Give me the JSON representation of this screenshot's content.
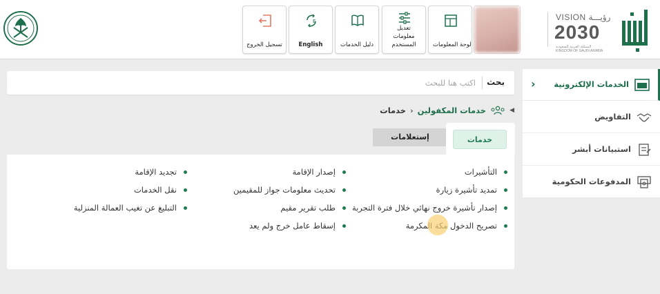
{
  "header": {
    "logout_label": "تسجيل الخروج",
    "english_label": "English",
    "services_guide_label": "دليل الخدمات",
    "edit_info_label": "تعديل معلومات المستخدم",
    "dashboard_label": "لوحة المعلومات",
    "vision_title": "VISION رؤيـــة",
    "vision_year": "2030",
    "vision_sub_ar": "المملكة العربية السعودية",
    "vision_sub_en": "KINGDOM OF SAUDI ARABIA",
    "accent": "#1e6f4c"
  },
  "search": {
    "label": "بحث",
    "placeholder": "اكتب هنا للبحث"
  },
  "breadcrumb": {
    "items": [
      "خدمات المكفولين",
      "خدمات"
    ]
  },
  "tabs": {
    "active": "خدمات",
    "inactive": "إستعلامات"
  },
  "services": {
    "col1": [
      "التأشيرات",
      "تمديد تأشيرة زيارة",
      "إصدار تأشيرة خروج نهائي خلال فترة التجربة",
      "تصريح الدخول مكة المكرمة"
    ],
    "col2": [
      "إصدار الإقامة",
      "تحديث معلومات جواز للمقيمين",
      "طلب تقرير مقيم",
      "إسقاط عامل خرج ولم يعد"
    ],
    "col3": [
      "تجديد الإقامة",
      "نقل الخدمات",
      "التبليغ عن تغيب العمالة المنزلية"
    ]
  },
  "sidebar": {
    "items": [
      {
        "label": "الخدمات الإلكترونية",
        "icon": "dashboard-icon"
      },
      {
        "label": "التفاويض",
        "icon": "handshake-icon"
      },
      {
        "label": "استبيانات أبشر",
        "icon": "survey-icon"
      },
      {
        "label": "المدفوعات الحكومية",
        "icon": "payments-icon"
      }
    ]
  }
}
